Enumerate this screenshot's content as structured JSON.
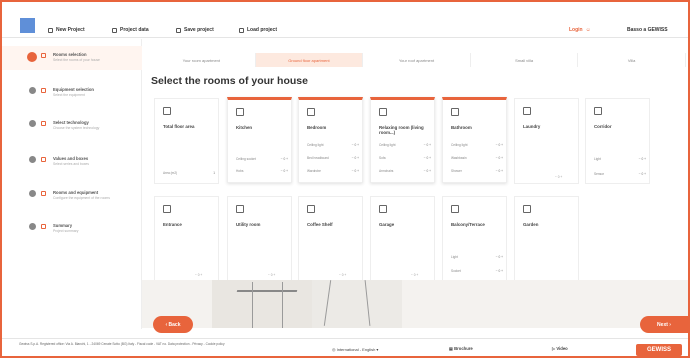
{
  "topbar": {
    "new_project": "New Project",
    "project_data": "Project data",
    "save_project": "Save project",
    "load_project": "Load project",
    "login": "Login",
    "user": "Basso a GEWISS"
  },
  "steps": [
    {
      "title": "Rooms selection",
      "sub": "Select the rooms of your house"
    },
    {
      "title": "Equipment selection",
      "sub": "Select the equipment"
    },
    {
      "title": "Select technology",
      "sub": "Choose the system technology"
    },
    {
      "title": "Values and boxes",
      "sub": "Select series and boxes"
    },
    {
      "title": "Rooms and equipment",
      "sub": "Configure the equipment of the rooms"
    },
    {
      "title": "Summary",
      "sub": "Project summary"
    }
  ],
  "subtabs": [
    "Your room apartment",
    "Ground floor apartment",
    "Your roof apartment",
    "Small villa",
    "Villa"
  ],
  "heading": "Select the rooms of your house",
  "rooms": [
    {
      "name": "Total floor area",
      "rows": [
        "Area (m2)"
      ],
      "qty": "1"
    },
    {
      "name": "Kitchen",
      "rows": [
        "Ceiling socket",
        "Hobs"
      ]
    },
    {
      "name": "Bedroom",
      "rows": [
        "Ceiling light",
        "Bed headboard",
        "Wardrobe"
      ]
    },
    {
      "name": "Relaxing room (living room...)",
      "rows": [
        "Ceiling light",
        "Sofa",
        "Armchairs"
      ]
    },
    {
      "name": "Bathroom",
      "rows": [
        "Ceiling light",
        "Washbasin",
        "Shower"
      ]
    },
    {
      "name": "Laundry",
      "rows": []
    },
    {
      "name": "Corridor",
      "rows": [
        "Light",
        "Sensor"
      ]
    },
    {
      "name": "Entrance",
      "rows": []
    },
    {
      "name": "Utility room",
      "rows": []
    },
    {
      "name": "Coffee Shelf",
      "rows": []
    },
    {
      "name": "Garage",
      "rows": []
    },
    {
      "name": "Balcony/Terrace",
      "rows": [
        "Light",
        "Socket"
      ]
    },
    {
      "name": "Garden",
      "rows": []
    }
  ],
  "qty_label": "0",
  "back_label": "‹ Back",
  "next_label": "Next ›",
  "footer": {
    "text": "Gewiss S.p.A. Registered office: Via A. Bianchi, 1 - 24069 Cenate Sotto (BG) Italy - Fiscal code - VAT no. Data protection - Privacy - Cookie policy",
    "language": "International - English",
    "brochure": "Brochure",
    "video": "Video",
    "brand": "GEWISS"
  },
  "colors": {
    "accent": "#e8643c",
    "logo": "#5f8fd8"
  }
}
